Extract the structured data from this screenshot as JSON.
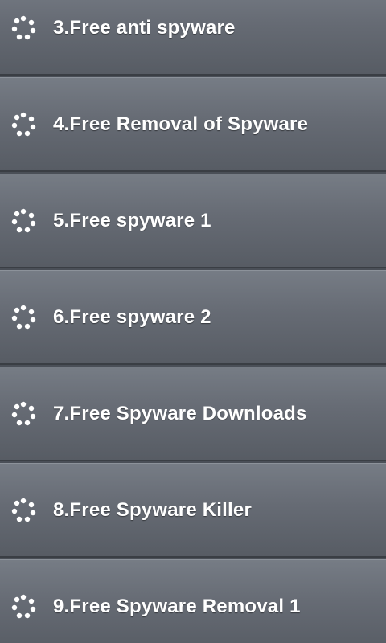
{
  "list": {
    "items": [
      {
        "label": "3.Free anti spyware"
      },
      {
        "label": "4.Free Removal of Spyware"
      },
      {
        "label": "5.Free spyware 1"
      },
      {
        "label": "6.Free spyware 2"
      },
      {
        "label": "7.Free Spyware Downloads"
      },
      {
        "label": "8.Free Spyware Killer"
      },
      {
        "label": "9.Free Spyware Removal 1"
      }
    ],
    "icon": "loading-dots-icon"
  },
  "colors": {
    "row_top": "#767c85",
    "row_bottom": "#575c64",
    "separator": "#3a3e44",
    "text": "#ffffff"
  }
}
